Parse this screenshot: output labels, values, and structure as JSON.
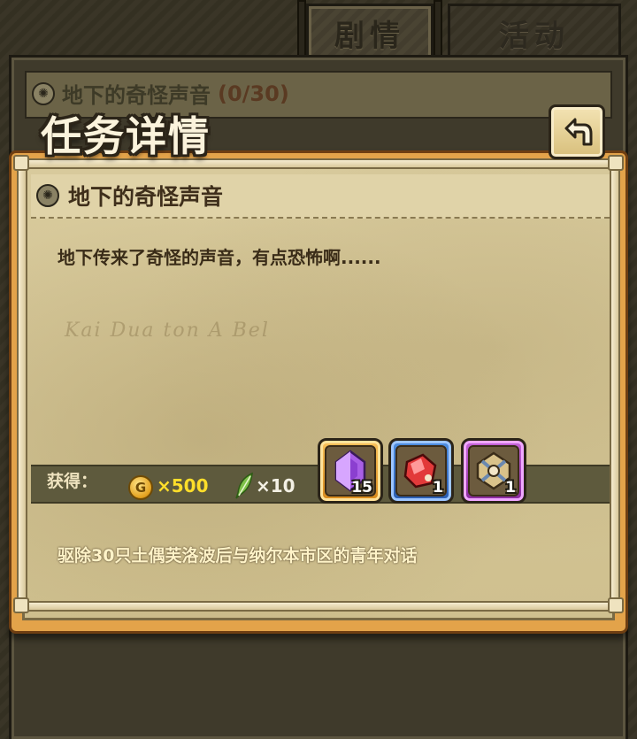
{
  "tabs": [
    {
      "label": "剧情",
      "active": true
    },
    {
      "label": "活动",
      "active": false
    }
  ],
  "quest_list": {
    "item_title": "地下的奇怪声音",
    "item_progress": "(0/30)"
  },
  "dialog": {
    "title": "任务详情",
    "back_icon": "return-arrow-icon",
    "quest_name": "地下的奇怪声音",
    "description": "地下传来了奇怪的声音，有点恐怖啊......",
    "map_watermark": "Kai Dua ton A Bel",
    "rewards": {
      "label": "获得：",
      "coin_icon": "G",
      "gold_amount": "×500",
      "feather_amount": "×10",
      "items": [
        {
          "icon": "purple-crystal-icon",
          "count": "15",
          "frame": "orange"
        },
        {
          "icon": "red-ore-icon",
          "count": "1",
          "frame": "blue"
        },
        {
          "icon": "compass-map-icon",
          "count": "1",
          "frame": "purple"
        }
      ]
    },
    "objective": "驱除30只土偶芙洛波后与纳尔本市区的青年对话"
  },
  "colors": {
    "dialog_border": "#e3a34a",
    "parchment": "#d8ca9c",
    "gold_text": "#ffde2a",
    "objective_text": "#fff3c8"
  }
}
